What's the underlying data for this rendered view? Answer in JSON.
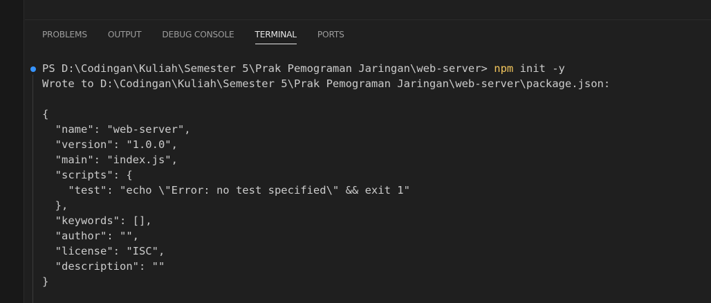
{
  "panel": {
    "tabs": [
      {
        "label": "PROBLEMS",
        "active": false
      },
      {
        "label": "OUTPUT",
        "active": false
      },
      {
        "label": "DEBUG CONSOLE",
        "active": false
      },
      {
        "label": "TERMINAL",
        "active": true
      },
      {
        "label": "PORTS",
        "active": false
      }
    ]
  },
  "terminal": {
    "prompt": "PS D:\\Codingan\\Kuliah\\Semester 5\\Prak Pemograman Jaringan\\web-server> ",
    "command_name": "npm",
    "command_args": " init -y",
    "output_lines": [
      "Wrote to D:\\Codingan\\Kuliah\\Semester 5\\Prak Pemograman Jaringan\\web-server\\package.json:",
      "",
      "{",
      "  \"name\": \"web-server\",",
      "  \"version\": \"1.0.0\",",
      "  \"main\": \"index.js\",",
      "  \"scripts\": {",
      "    \"test\": \"echo \\\"Error: no test specified\\\" && exit 1\"",
      "  },",
      "  \"keywords\": [],",
      "  \"author\": \"\",",
      "  \"license\": \"ISC\",",
      "  \"description\": \"\"",
      "}"
    ]
  },
  "colors": {
    "background": "#1f1f1f",
    "text": "#cccccc",
    "command_highlight": "#f2c55c",
    "decoration_dot": "#3794ff"
  }
}
